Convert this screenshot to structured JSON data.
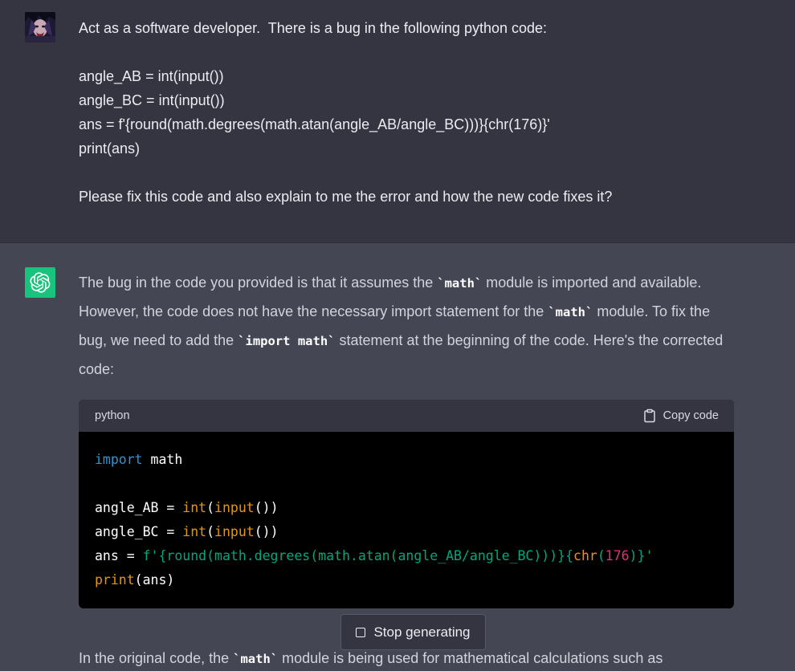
{
  "user_message": {
    "intro": "Act as a software developer.  There is a bug in the following python code:",
    "code_lines": [
      "angle_AB = int(input())",
      "angle_BC = int(input())",
      "ans = f'{round(math.degrees(math.atan(angle_AB/angle_BC)))}{chr(176)}'",
      "print(ans)"
    ],
    "request": "Please fix this code and also explain to me the error and how the new code fixes it?"
  },
  "assistant_message": {
    "p1_a": "The bug in the code you provided is that it assumes the ",
    "code_math": "`math`",
    "p1_b": " module is imported and available. However, the code does not have the necessary import statement for the ",
    "p1_c": " module. To fix the bug, we need to add the ",
    "code_import": "`import math`",
    "p1_d": " statement at the beginning of the code. Here's the corrected code:",
    "code_block": {
      "language": "python",
      "copy_label": "Copy code"
    },
    "cut_a": "In the original code, the ",
    "cut_b": " module is being used for mathematical calculations such as"
  },
  "controls": {
    "stop_label": "Stop generating"
  },
  "colors": {
    "user_bg": "#343541",
    "assistant_bg": "#444654",
    "gpt_avatar": "#19c37d",
    "keyword": "#2e95d3",
    "builtin": "#e9950c",
    "string": "#00a67d",
    "number": "#df3079"
  }
}
